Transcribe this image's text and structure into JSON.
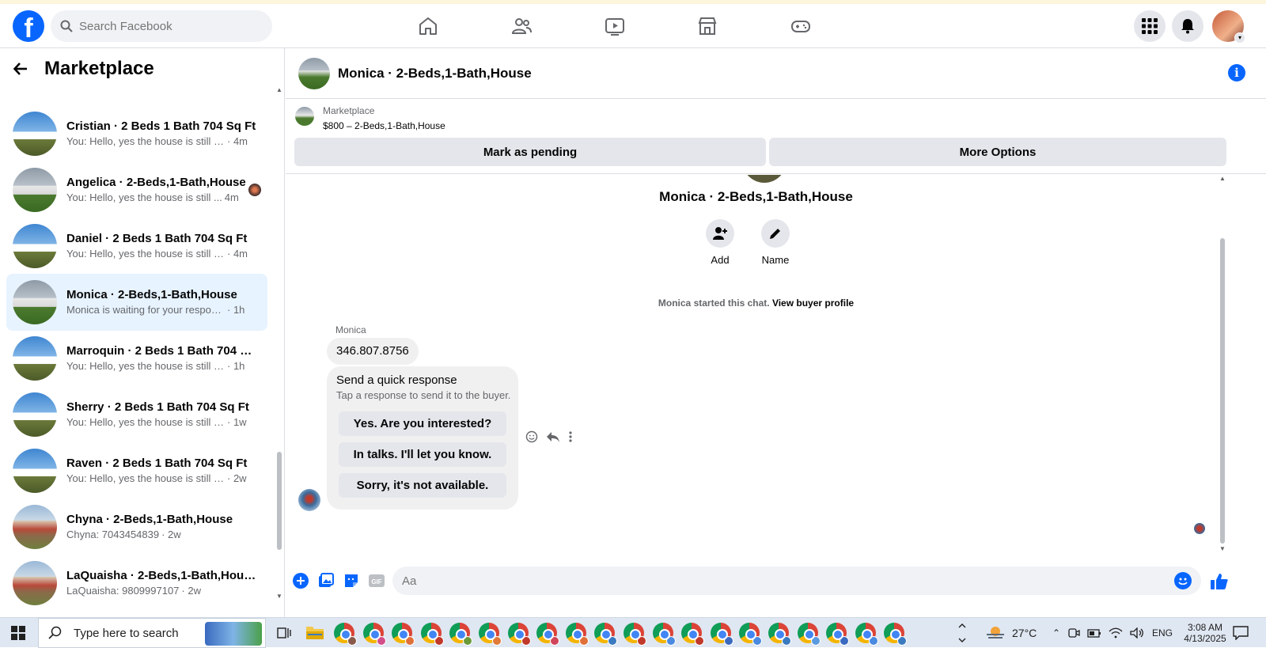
{
  "topnav": {
    "logo": "f",
    "search_placeholder": "Search Facebook",
    "icons": [
      "home-icon",
      "friends-icon",
      "watch-icon",
      "marketplace-icon",
      "gaming-icon"
    ],
    "right_icons": [
      "menu-grid-icon",
      "notifications-icon"
    ]
  },
  "sidebar": {
    "title": "Marketplace",
    "conversations": [
      {
        "name": "Cristian · 2 Beds 1 Bath 704 Sq Ft",
        "message": "You: Hello, yes the house is still av...",
        "time": "· 4m",
        "thumb": "blue",
        "active": false
      },
      {
        "name": "Angelica · 2-Beds,1-Bath,House",
        "message": "You: Hello, yes the house is still ...",
        "time": "4m",
        "thumb": "grey",
        "active": false,
        "seen": true
      },
      {
        "name": "Daniel · 2 Beds 1 Bath 704 Sq Ft",
        "message": "You: Hello, yes the house is still av...",
        "time": "· 4m",
        "thumb": "blue",
        "active": false
      },
      {
        "name": "Monica · 2-Beds,1-Bath,House",
        "message": "Monica is waiting for your response.",
        "time": "· 1h",
        "thumb": "grey",
        "active": true
      },
      {
        "name": "Marroquin · 2 Beds 1 Bath 704 S...",
        "message": "You: Hello, yes the house is still avai...",
        "time": "· 1h",
        "thumb": "blue",
        "active": false
      },
      {
        "name": "Sherry · 2 Beds 1 Bath 704 Sq Ft",
        "message": "You: Hello, yes the house is still ava...",
        "time": "· 1w",
        "thumb": "blue",
        "active": false
      },
      {
        "name": "Raven · 2 Beds 1 Bath 704 Sq Ft",
        "message": "You: Hello, yes the house is still ava...",
        "time": "· 2w",
        "thumb": "blue",
        "active": false
      },
      {
        "name": "Chyna · 2-Beds,1-Bath,House",
        "message": "Chyna: 7043454839",
        "time": "· 2w",
        "thumb": "red",
        "active": false
      },
      {
        "name": "LaQuaisha · 2-Beds,1-Bath,House",
        "message": "LaQuaisha: 9809997107",
        "time": "· 2w",
        "thumb": "red",
        "active": false
      }
    ]
  },
  "chat": {
    "header_name": "Monica · 2-Beds,1-Bath,House",
    "listing_label": "Marketplace",
    "listing_price": "$800 – 2-Beds,1-Bath,House",
    "mark_pending": "Mark as pending",
    "more_options": "More Options",
    "thread_title": "Monica · 2-Beds,1-Bath,House",
    "action_add": "Add",
    "action_name": "Name",
    "started_text": "Monica started this chat.",
    "view_profile": "View buyer profile",
    "sender": "Monica",
    "phone": "346.807.8756",
    "quick_title": "Send a quick response",
    "quick_sub": "Tap a response to send it to the buyer.",
    "quick_replies": [
      "Yes. Are you interested?",
      "In talks. I'll let you know.",
      "Sorry, it's not available."
    ],
    "composer_placeholder": "Aa"
  },
  "taskbar": {
    "search_text": "Type here to search",
    "weather": "27°C",
    "language": "ENG",
    "time": "3:08 AM",
    "date": "4/13/2025",
    "chrome_badge_colors": [
      "#8a5a4a",
      "#d34f8a",
      "#e0703a",
      "#c0392b",
      "#6a9a3a",
      "#e07a3a",
      "#c0392b",
      "#d0455a",
      "#e0703a",
      "#3a7ac0",
      "#c0392b",
      "#4a8ae0",
      "#c0392b",
      "#3a6ac0",
      "#4a8ae0",
      "#3a7ac0",
      "#5a9ae0",
      "#3a6ac0",
      "#4a8ae0",
      "#3a7ac0"
    ]
  }
}
